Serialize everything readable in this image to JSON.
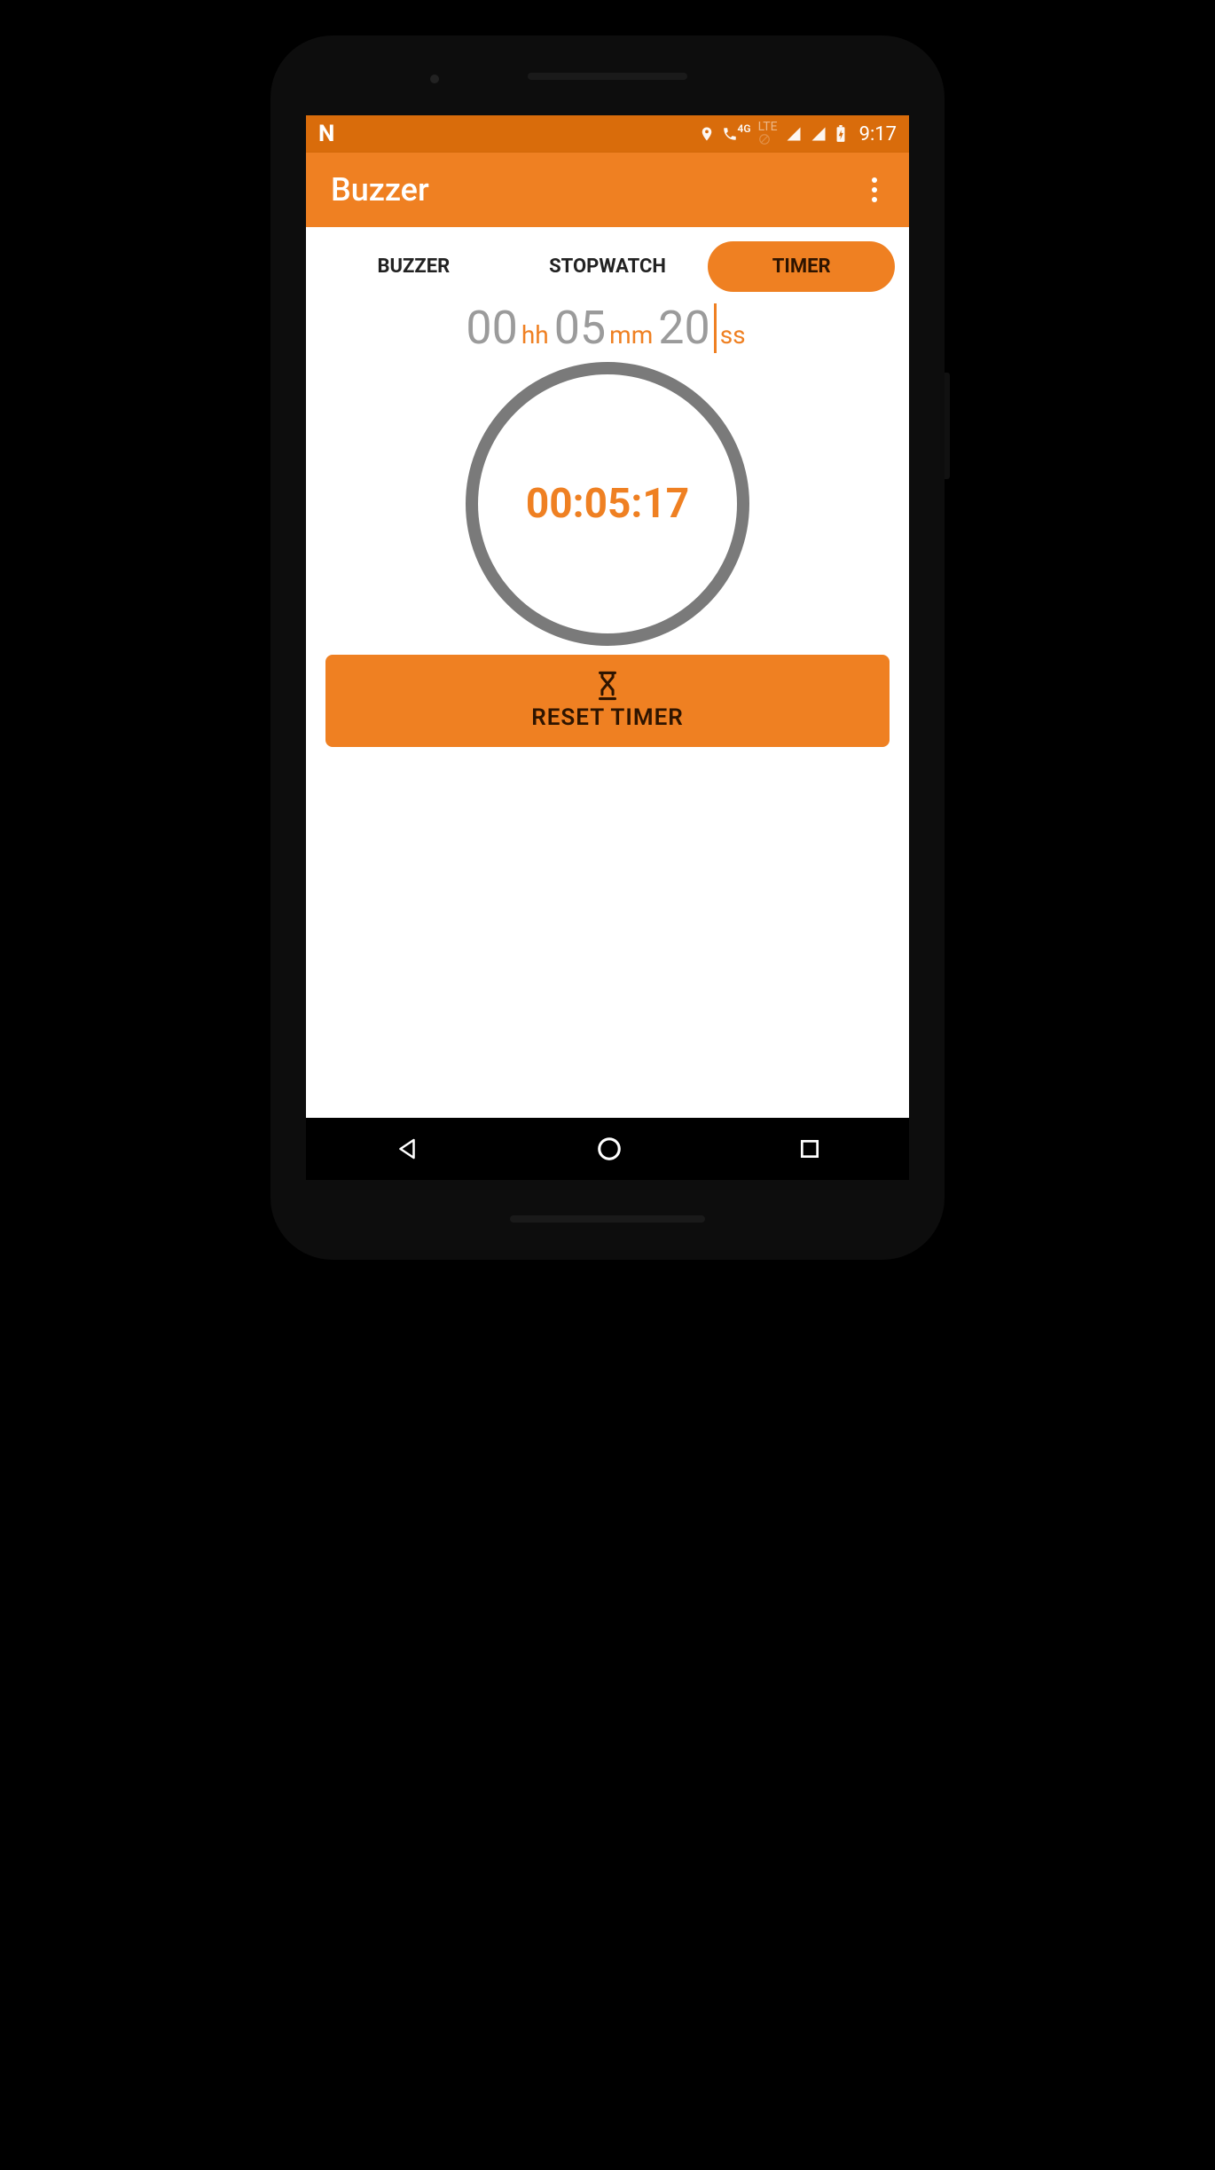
{
  "status": {
    "time": "9:17",
    "network_label_4g": "4G",
    "network_label_lte": "LTE"
  },
  "app": {
    "title": "Buzzer"
  },
  "tabs": {
    "items": [
      {
        "label": "BUZZER",
        "active": false
      },
      {
        "label": "STOPWATCH",
        "active": false
      },
      {
        "label": "TIMER",
        "active": true
      }
    ]
  },
  "timer_input": {
    "hours": "00",
    "hours_unit": "hh",
    "minutes": "05",
    "minutes_unit": "mm",
    "seconds": "20",
    "seconds_unit": "ss"
  },
  "timer_running": {
    "display": "00:05:17"
  },
  "reset_button": {
    "label": "RESET TIMER"
  },
  "colors": {
    "accent": "#ef8022",
    "accent_dark": "#d96c0b",
    "circle_ring": "#7a7a7a",
    "input_text": "#9b9b9b"
  }
}
